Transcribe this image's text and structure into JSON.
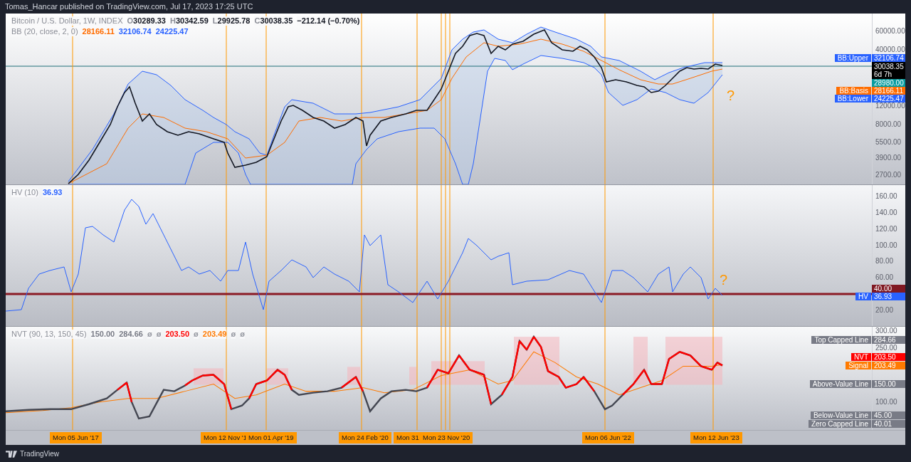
{
  "header": "Tomas_Hancar published on TradingView.com, Jul 17, 2023 17:25 UTC",
  "main_pane": {
    "symbol": "Bitcoin / U.S. Dollar, 1W, INDEX",
    "ohlc": [
      {
        "label": "O",
        "value": "30289.33"
      },
      {
        "label": "H",
        "value": "30342.59"
      },
      {
        "label": "L",
        "value": "29925.78"
      },
      {
        "label": "C",
        "value": "30038.35"
      }
    ],
    "change": "−212.14 (−0.70%)",
    "indicator": {
      "name": "BB (20, close, 2, 0)",
      "values": [
        {
          "text": "28166.11",
          "color": "#ff6d00"
        },
        {
          "text": "32106.74",
          "color": "#2962ff"
        },
        {
          "text": "24225.47",
          "color": "#2962ff"
        }
      ]
    },
    "axis_labels": [
      "60000.00",
      "40000.00",
      "12000.00",
      "8000.00",
      "5500.00",
      "3900.00",
      "2700.00"
    ],
    "badges": [
      {
        "label": "BB:Upper",
        "value": "32106.74",
        "color": "#2962ff"
      },
      {
        "value": "30038.35",
        "sub": "6d 7h",
        "color": "#000000"
      },
      {
        "value": "28980.00",
        "color": "#089ca0"
      },
      {
        "label": "BB:Basis",
        "value": "28166.11",
        "color": "#ff6d00"
      },
      {
        "label": "BB:Lower",
        "value": "24225.47",
        "color": "#2962ff"
      }
    ],
    "annotation": "?"
  },
  "hv_pane": {
    "indicator": {
      "name": "HV (10)",
      "values": [
        {
          "text": "36.93",
          "color": "#2962ff"
        }
      ]
    },
    "axis_labels": [
      "160.00",
      "140.00",
      "120.00",
      "100.00",
      "80.00",
      "60.00",
      "20.00"
    ],
    "badges": [
      {
        "value": "40.00",
        "color": "#801922"
      },
      {
        "label": "HV",
        "value": "36.93",
        "color": "#2962ff"
      }
    ],
    "annotation": "?"
  },
  "nvt_pane": {
    "indicator": {
      "name": "NVT (90, 13, 150, 45)",
      "values": [
        {
          "text": "150.00",
          "color": "#787b86"
        },
        {
          "text": "284.66",
          "color": "#787b86"
        },
        {
          "text": "ø",
          "color": "#9598a1"
        },
        {
          "text": "ø",
          "color": "#9598a1"
        },
        {
          "text": "203.50",
          "color": "#ff0000"
        },
        {
          "text": "ø",
          "color": "#9598a1"
        },
        {
          "text": "203.49",
          "color": "#ff7a00"
        },
        {
          "text": "ø",
          "color": "#9598a1"
        },
        {
          "text": "ø",
          "color": "#9598a1"
        }
      ]
    },
    "axis_labels": [
      "300.00",
      "250.00",
      "100.00"
    ],
    "badges": [
      {
        "label": "Top Capped Line",
        "value": "284.66",
        "color": "#787b86"
      },
      {
        "label": "NVT",
        "value": "203.50",
        "color": "#ff0000"
      },
      {
        "label": "Signal",
        "value": "203.49",
        "color": "#ff7a00"
      },
      {
        "label": "Above-Value Line",
        "value": "150.00",
        "color": "#787b86"
      },
      {
        "label": "Below-Value Line",
        "value": "45.00",
        "color": "#787b86"
      },
      {
        "label": "Zero Capped Line",
        "value": "40.01",
        "color": "#787b86"
      }
    ]
  },
  "time_markers": [
    "Mon 05 Jun '17",
    "Mon 12 Nov '1",
    "Mon 01 Apr '19",
    "Mon 24 Feb '20",
    "Mon 31",
    "Mon 23 Nov '20",
    "Mon 06 Jun '22",
    "Mon 12 Jun '23"
  ],
  "footer": {
    "brand": "TradingView"
  }
}
